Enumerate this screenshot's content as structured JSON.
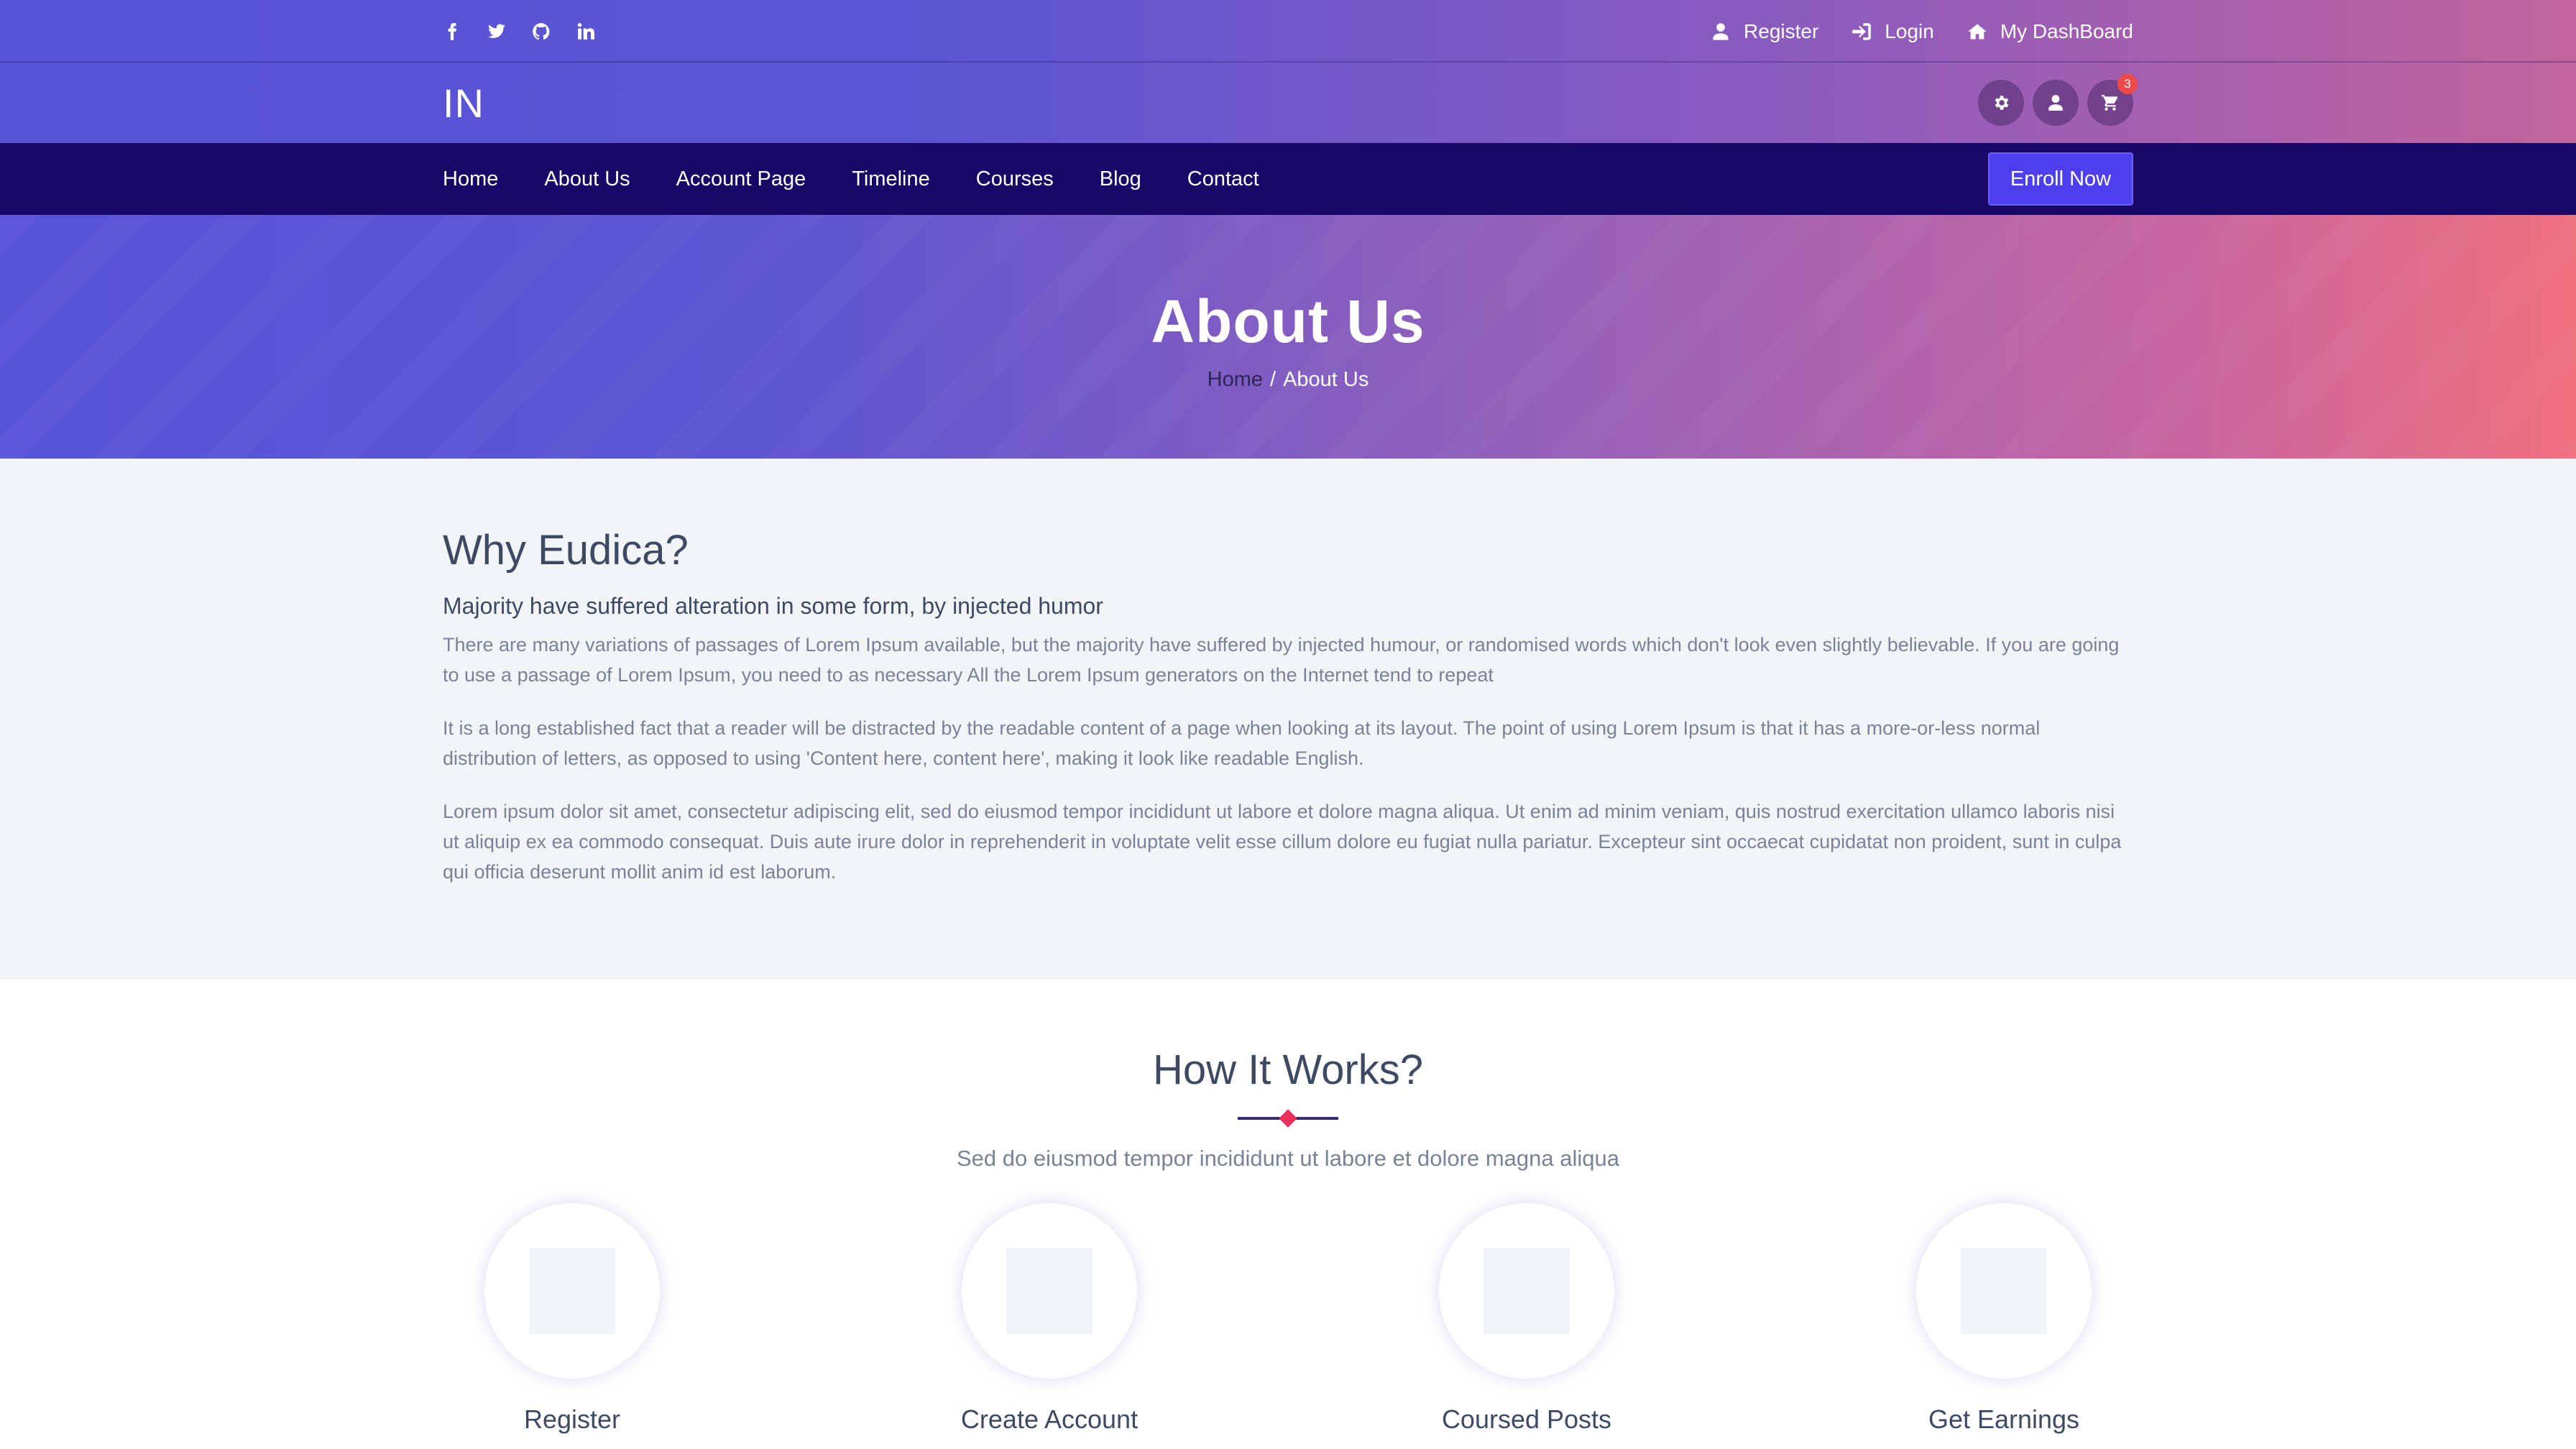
{
  "topbar": {
    "social": [
      {
        "icon": "facebook-icon"
      },
      {
        "icon": "twitter-icon"
      },
      {
        "icon": "github-icon"
      },
      {
        "icon": "linkedin-icon"
      }
    ],
    "links": [
      {
        "label": "Register",
        "icon": "user-icon"
      },
      {
        "label": "Login",
        "icon": "sign-in-icon"
      },
      {
        "label": "My DashBoard",
        "icon": "home-icon"
      }
    ]
  },
  "brand": {
    "logo": "IN",
    "cart_count": "3"
  },
  "nav": {
    "items": [
      "Home",
      "About Us",
      "Account Page",
      "Timeline",
      "Courses",
      "Blog",
      "Contact"
    ],
    "cta": "Enroll Now"
  },
  "hero": {
    "title": "About Us",
    "breadcrumb": {
      "home": "Home",
      "sep": "/",
      "current": "About Us"
    }
  },
  "why": {
    "title": "Why Eudica?",
    "subtitle": "Majority have suffered alteration in some form, by injected humor",
    "paragraphs": [
      "There are many variations of passages of Lorem Ipsum available, but the majority have suffered by injected humour, or randomised words which don't look even slightly believable. If you are going to use a passage of Lorem Ipsum, you need to as necessary All the Lorem Ipsum generators on the Internet tend to repeat",
      "It is a long established fact that a reader will be distracted by the readable content of a page when looking at its layout. The point of using Lorem Ipsum is that it has a more-or-less normal distribution of letters, as opposed to using 'Content here, content here', making it look like readable English.",
      "Lorem ipsum dolor sit amet, consectetur adipiscing elit, sed do eiusmod tempor incididunt ut labore et dolore magna aliqua. Ut enim ad minim veniam, quis nostrud exercitation ullamco laboris nisi ut aliquip ex ea commodo consequat. Duis aute irure dolor in reprehenderit in voluptate velit esse cillum dolore eu fugiat nulla pariatur. Excepteur sint occaecat cupidatat non proident, sunt in culpa qui officia deserunt mollit anim id est laborum."
    ]
  },
  "how": {
    "title": "How It Works?",
    "subtitle": "Sed do eiusmod tempor incididunt ut labore et dolore magna aliqua",
    "steps": [
      "Register",
      "Create Account",
      "Coursed Posts",
      "Get Earnings"
    ]
  },
  "colors": {
    "nav_bg": "#180766",
    "cta_bg": "#4d3ef0",
    "accent_diamond": "#e8305a",
    "badge": "#f0494a",
    "section_bg": "#f2f5f8"
  }
}
